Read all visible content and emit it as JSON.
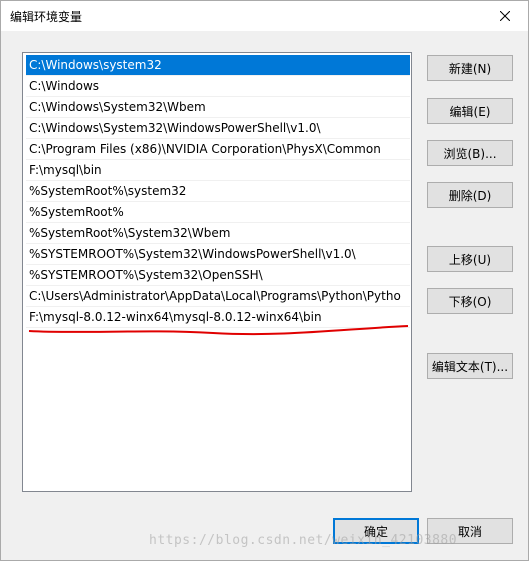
{
  "window": {
    "title": "编辑环境变量"
  },
  "paths": [
    "C:\\Windows\\system32",
    "C:\\Windows",
    "C:\\Windows\\System32\\Wbem",
    "C:\\Windows\\System32\\WindowsPowerShell\\v1.0\\",
    "C:\\Program Files (x86)\\NVIDIA Corporation\\PhysX\\Common",
    "F:\\mysql\\bin",
    "%SystemRoot%\\system32",
    "%SystemRoot%",
    "%SystemRoot%\\System32\\Wbem",
    "%SYSTEMROOT%\\System32\\WindowsPowerShell\\v1.0\\",
    "%SYSTEMROOT%\\System32\\OpenSSH\\",
    "C:\\Users\\Administrator\\AppData\\Local\\Programs\\Python\\Pytho",
    "F:\\mysql-8.0.12-winx64\\mysql-8.0.12-winx64\\bin"
  ],
  "selected_index": 0,
  "buttons": {
    "new": "新建(N)",
    "edit": "编辑(E)",
    "browse": "浏览(B)...",
    "delete": "删除(D)",
    "move_up": "上移(U)",
    "move_down": "下移(O)",
    "edit_text": "编辑文本(T)...",
    "ok": "确定",
    "cancel": "取消"
  },
  "watermark": "https://blog.csdn.net/weixin_42103880",
  "colors": {
    "selection": "#0078d7",
    "annotation": "#e00000"
  }
}
